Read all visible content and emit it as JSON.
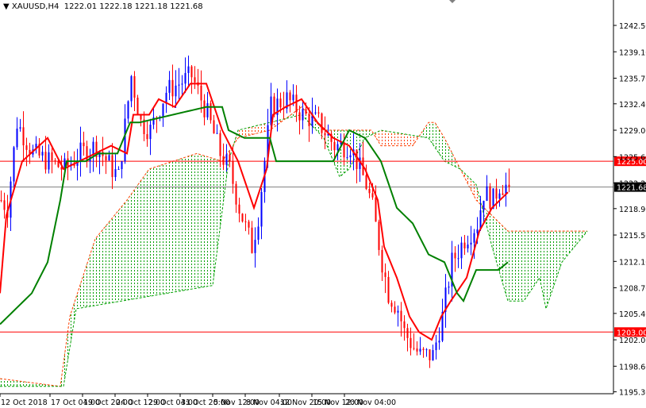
{
  "header": {
    "symbol": "XAUUSD,H4",
    "ohlc": "1222.01 1222.18 1221.18 1221.68"
  },
  "colors": {
    "bull": "#0000ff",
    "bear": "#ff0000",
    "tenkan": "#ff0000",
    "kijun": "#008000",
    "cloud_up": "#00a000",
    "cloud_down": "#ff4000",
    "current": "#808080"
  },
  "chart_data": {
    "type": "candlestick",
    "symbol": "XAUUSD",
    "timeframe": "H4",
    "ylim": [
      1195.3,
      1244
    ],
    "y_ticks": [
      "1242.50",
      "1239.10",
      "1235.70",
      "1232.40",
      "1229.00",
      "1225.60",
      "1222.20",
      "1218.90",
      "1215.50",
      "1212.10",
      "1208.70",
      "1205.40",
      "1202.00",
      "1198.60",
      "1195.30"
    ],
    "x_ticks": [
      "12 Oct 2018",
      "17 Oct 04:00",
      "19 Oct 20:00",
      "24 Oct 12:00",
      "29 Oct 04:00",
      "31 Oct 20:00",
      "5 Nov 12:00",
      "8 Nov 04:00",
      "12 Nov 20:00",
      "15 Nov 12:00",
      "20 Nov 04:00"
    ],
    "bar_index_max": 185,
    "close_keypoints": [
      [
        0,
        1220
      ],
      [
        2,
        1219
      ],
      [
        5,
        1230
      ],
      [
        10,
        1226
      ],
      [
        15,
        1225
      ],
      [
        20,
        1224
      ],
      [
        25,
        1226
      ],
      [
        30,
        1227
      ],
      [
        35,
        1224
      ],
      [
        37,
        1223
      ],
      [
        41,
        1236
      ],
      [
        44,
        1230
      ],
      [
        47,
        1229
      ],
      [
        52,
        1234
      ],
      [
        60,
        1236
      ],
      [
        65,
        1231
      ],
      [
        69,
        1226
      ],
      [
        72,
        1224
      ],
      [
        75,
        1219
      ],
      [
        79,
        1214
      ],
      [
        81,
        1218
      ],
      [
        85,
        1232
      ],
      [
        90,
        1233
      ],
      [
        95,
        1231
      ],
      [
        100,
        1230
      ],
      [
        105,
        1227
      ],
      [
        110,
        1227
      ],
      [
        115,
        1222
      ],
      [
        117,
        1219
      ],
      [
        120,
        1212
      ],
      [
        122,
        1208
      ],
      [
        125,
        1206
      ],
      [
        127,
        1203
      ],
      [
        130,
        1201
      ],
      [
        132,
        1200
      ],
      [
        136,
        1200
      ],
      [
        139,
        1205
      ],
      [
        142,
        1212
      ],
      [
        146,
        1215
      ],
      [
        150,
        1217
      ],
      [
        152,
        1221
      ],
      [
        155,
        1220
      ],
      [
        157,
        1222
      ],
      [
        160,
        1221.68
      ]
    ],
    "tenkan_keypoints": [
      [
        0,
        1208
      ],
      [
        2,
        1218
      ],
      [
        7,
        1225
      ],
      [
        15,
        1228
      ],
      [
        20,
        1224
      ],
      [
        25,
        1225
      ],
      [
        35,
        1227
      ],
      [
        40,
        1226
      ],
      [
        42,
        1231
      ],
      [
        47,
        1231
      ],
      [
        50,
        1233
      ],
      [
        55,
        1232
      ],
      [
        60,
        1235
      ],
      [
        65,
        1235
      ],
      [
        70,
        1229
      ],
      [
        75,
        1225
      ],
      [
        80,
        1219
      ],
      [
        84,
        1224
      ],
      [
        86,
        1231
      ],
      [
        90,
        1232
      ],
      [
        95,
        1233
      ],
      [
        100,
        1230
      ],
      [
        105,
        1228
      ],
      [
        110,
        1227
      ],
      [
        115,
        1224
      ],
      [
        119,
        1220
      ],
      [
        121,
        1214
      ],
      [
        125,
        1210
      ],
      [
        129,
        1205
      ],
      [
        132,
        1203
      ],
      [
        136,
        1202
      ],
      [
        139,
        1205
      ],
      [
        142,
        1207
      ],
      [
        147,
        1210
      ],
      [
        151,
        1216
      ],
      [
        155,
        1219
      ],
      [
        160,
        1221
      ]
    ],
    "kijun_keypoints": [
      [
        0,
        1204
      ],
      [
        5,
        1206
      ],
      [
        10,
        1208
      ],
      [
        15,
        1212
      ],
      [
        19,
        1220
      ],
      [
        21,
        1225
      ],
      [
        27,
        1225
      ],
      [
        31,
        1226
      ],
      [
        37,
        1226
      ],
      [
        41,
        1230
      ],
      [
        44,
        1230
      ],
      [
        65,
        1232
      ],
      [
        70,
        1232
      ],
      [
        72,
        1229
      ],
      [
        77,
        1228
      ],
      [
        85,
        1228
      ],
      [
        87,
        1225
      ],
      [
        105,
        1225
      ],
      [
        110,
        1229
      ],
      [
        115,
        1228
      ],
      [
        120,
        1225
      ],
      [
        125,
        1219
      ],
      [
        130,
        1217
      ],
      [
        135,
        1213
      ],
      [
        140,
        1212
      ],
      [
        144,
        1208
      ],
      [
        146,
        1207
      ],
      [
        150,
        1211
      ],
      [
        157,
        1211
      ],
      [
        160,
        1212
      ]
    ],
    "span_a_keypoints": [
      [
        0,
        1197
      ],
      [
        19,
        1196
      ],
      [
        22,
        1205
      ],
      [
        30,
        1215
      ],
      [
        40,
        1220
      ],
      [
        47,
        1224
      ],
      [
        62,
        1226
      ],
      [
        70,
        1225
      ],
      [
        75,
        1228
      ],
      [
        85,
        1229
      ],
      [
        95,
        1232
      ],
      [
        102,
        1229
      ],
      [
        117,
        1229
      ],
      [
        120,
        1227
      ],
      [
        130,
        1227
      ],
      [
        135,
        1230
      ],
      [
        137,
        1230
      ],
      [
        140,
        1228
      ],
      [
        145,
        1224
      ],
      [
        150,
        1220
      ],
      [
        155,
        1218
      ],
      [
        160,
        1216
      ],
      [
        185,
        1216
      ]
    ],
    "span_b_keypoints": [
      [
        0,
        1196
      ],
      [
        20,
        1196
      ],
      [
        24,
        1206
      ],
      [
        67,
        1209
      ],
      [
        72,
        1225
      ],
      [
        75,
        1229
      ],
      [
        85,
        1230
      ],
      [
        95,
        1231
      ],
      [
        102,
        1228
      ],
      [
        107,
        1223
      ],
      [
        110,
        1224
      ],
      [
        115,
        1228
      ],
      [
        120,
        1229
      ],
      [
        135,
        1228
      ],
      [
        140,
        1225
      ],
      [
        145,
        1224
      ],
      [
        150,
        1222
      ],
      [
        155,
        1214
      ],
      [
        160,
        1207
      ],
      [
        165,
        1207
      ],
      [
        170,
        1210
      ],
      [
        172,
        1206
      ],
      [
        177,
        1212
      ],
      [
        185,
        1216
      ]
    ],
    "levels": [
      {
        "label": "1225.00",
        "value": 1225.0,
        "kind": "resistance"
      },
      {
        "label": "1203.00",
        "value": 1203.0,
        "kind": "support"
      },
      {
        "label": "1221.68",
        "value": 1221.68,
        "kind": "current"
      }
    ]
  }
}
